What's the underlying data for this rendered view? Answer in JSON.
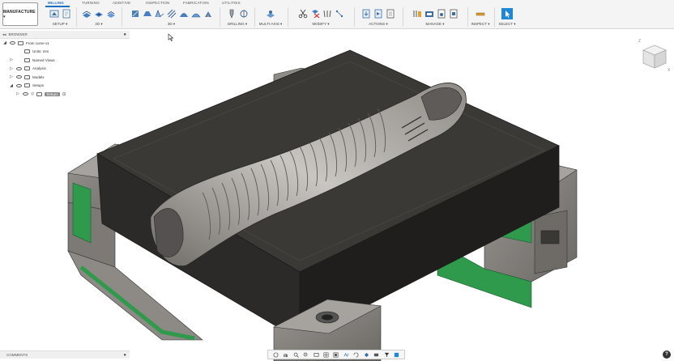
{
  "workspace": {
    "label": "MANUFACTURE ▾"
  },
  "tabs": [
    {
      "label": "MILLING"
    },
    {
      "label": "TURNING"
    },
    {
      "label": "ADDITIVE"
    },
    {
      "label": "INSPECTION"
    },
    {
      "label": "FABRICATION"
    },
    {
      "label": "UTILITIES"
    }
  ],
  "groups": {
    "setup": "SETUP ▾",
    "twod": "2D ▾",
    "threed": "3D ▾",
    "drilling": "DRILLING ▾",
    "multiaxis": "MULTI-AXIS ▾",
    "modify": "MODIFY ▾",
    "actions": "ACTIONS ▾",
    "manage": "MANAGE ▾",
    "inspect": "INSPECT ▾",
    "select": "SELECT ▾"
  },
  "browser": {
    "title": "BROWSER",
    "items": [
      {
        "label": "From curve v1"
      },
      {
        "label": "Units: mm"
      },
      {
        "label": "Named Views"
      },
      {
        "label": "Analysis"
      },
      {
        "label": "Models"
      },
      {
        "label": "Setups"
      },
      {
        "label": "Setup1"
      }
    ]
  },
  "comments": {
    "label": "COMMENTS"
  },
  "colors": {
    "accent": "#1a6fc1",
    "mold_body": "#3a3835",
    "clamp_green": "#2f9a4c",
    "vise_grey": "#8d8a86"
  }
}
